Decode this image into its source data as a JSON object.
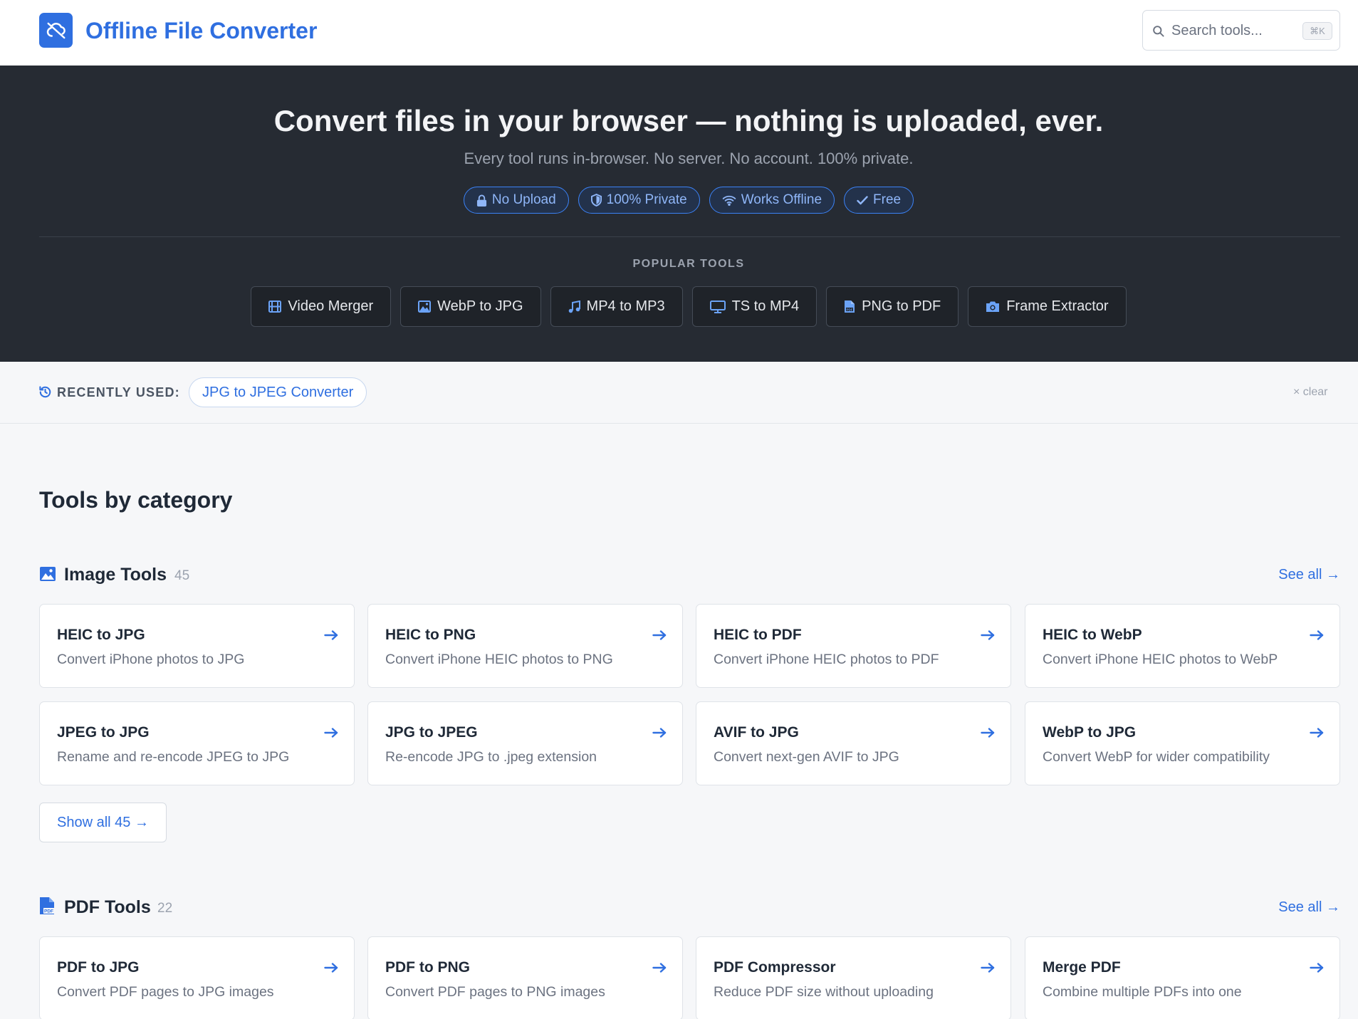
{
  "header": {
    "app_title": "Offline File Converter",
    "search_placeholder": "Search tools...",
    "search_shortcut": "⌘K"
  },
  "hero": {
    "title": "Convert files in your browser — nothing is uploaded, ever.",
    "subtitle": "Every tool runs in-browser. No server. No account. 100% private.",
    "badges": [
      {
        "label": "No Upload",
        "icon": "lock-icon"
      },
      {
        "label": "100% Private",
        "icon": "shield-icon"
      },
      {
        "label": "Works Offline",
        "icon": "wifi-icon"
      },
      {
        "label": "Free",
        "icon": "check-icon"
      }
    ],
    "popular_label": "POPULAR TOOLS",
    "popular_tools": [
      {
        "label": "Video Merger",
        "icon": "film-icon"
      },
      {
        "label": "WebP to JPG",
        "icon": "image-icon"
      },
      {
        "label": "MP4 to MP3",
        "icon": "music-icon"
      },
      {
        "label": "TS to MP4",
        "icon": "monitor-icon"
      },
      {
        "label": "PNG to PDF",
        "icon": "pdf-file-icon"
      },
      {
        "label": "Frame Extractor",
        "icon": "camera-icon"
      }
    ]
  },
  "recent": {
    "label": "RECENTLY USED:",
    "items": [
      "JPG to JPEG Converter"
    ],
    "clear_label": "× clear"
  },
  "main": {
    "heading": "Tools by category",
    "sections": [
      {
        "title": "Image Tools",
        "count": "45",
        "icon": "image-icon",
        "see_all": "See all →",
        "show_all": "Show all 45 →",
        "tools": [
          {
            "title": "HEIC to JPG",
            "desc": "Convert iPhone photos to JPG"
          },
          {
            "title": "HEIC to PNG",
            "desc": "Convert iPhone HEIC photos to PNG"
          },
          {
            "title": "HEIC to PDF",
            "desc": "Convert iPhone HEIC photos to PDF"
          },
          {
            "title": "HEIC to WebP",
            "desc": "Convert iPhone HEIC photos to WebP"
          },
          {
            "title": "JPEG to JPG",
            "desc": "Rename and re-encode JPEG to JPG"
          },
          {
            "title": "JPG to JPEG",
            "desc": "Re-encode JPG to .jpeg extension"
          },
          {
            "title": "AVIF to JPG",
            "desc": "Convert next-gen AVIF to JPG"
          },
          {
            "title": "WebP to JPG",
            "desc": "Convert WebP for wider compatibility"
          }
        ]
      },
      {
        "title": "PDF Tools",
        "count": "22",
        "icon": "pdf-file-icon",
        "see_all": "See all →",
        "tools": [
          {
            "title": "PDF to JPG",
            "desc": "Convert PDF pages to JPG images"
          },
          {
            "title": "PDF to PNG",
            "desc": "Convert PDF pages to PNG images"
          },
          {
            "title": "PDF Compressor",
            "desc": "Reduce PDF size without uploading"
          },
          {
            "title": "Merge PDF",
            "desc": "Combine multiple PDFs into one"
          }
        ]
      }
    ]
  },
  "colors": {
    "accent": "#2f6fe0",
    "hero_bg": "#262b33",
    "page_bg": "#f6f7f9"
  }
}
